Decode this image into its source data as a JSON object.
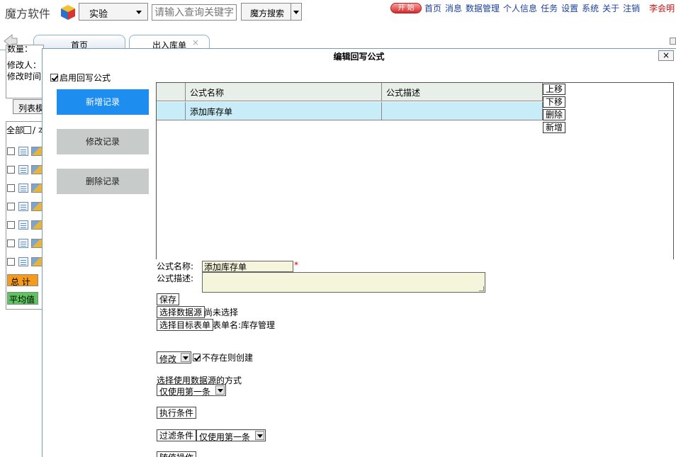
{
  "header": {
    "logo_text": "魔方软件",
    "module_select": "实验",
    "search_placeholder": "请输入查询关键字",
    "search_button": "魔方搜索",
    "start_button": "开 始",
    "nav": [
      "首页",
      "消息",
      "数据管理",
      "个人信息",
      "任务",
      "设置",
      "系统",
      "关于",
      "注销"
    ],
    "user": "李会明"
  },
  "tabs": [
    {
      "label": "首页"
    },
    {
      "label": "出入库单",
      "close": "×"
    }
  ],
  "left_panel": {
    "lines": [
      "数量：",
      "修改人：",
      "修改时间"
    ],
    "list_button": "列表模",
    "all_label": "全部",
    "all_suffix": "/ 本",
    "total_label": "总  计",
    "avg_label": "平均值"
  },
  "modal": {
    "title": "编辑回写公式",
    "close": "×",
    "enable_label": "启用回写公式",
    "side_buttons": [
      "新增记录",
      "修改记录",
      "删除记录"
    ],
    "grid": {
      "columns": [
        "公式名称",
        "公式描述"
      ],
      "rows": [
        [
          "添加库存单",
          ""
        ]
      ]
    },
    "grid_controls": [
      "上移",
      "下移",
      "删除",
      "新增"
    ],
    "form": {
      "name_label": "公式名称:",
      "name_value": "添加库存单",
      "required_mark": "*",
      "desc_label": "公式描述:",
      "save_button": "保存",
      "select_source_button": "选择数据源",
      "source_status": "尚未选择",
      "select_target_button": "选择目标表单",
      "target_info": "表单名:库存管理",
      "mode_value": "修改",
      "create_if_missing": "不存在则创建",
      "usage_label": "选择使用数据源的方式",
      "usage_value": "仅使用第一条",
      "exec_condition_button": "执行条件",
      "filter_condition_button": "过滤条件",
      "filter_usage_value": "仅使用第一条",
      "follow_button": "随值操作"
    }
  }
}
